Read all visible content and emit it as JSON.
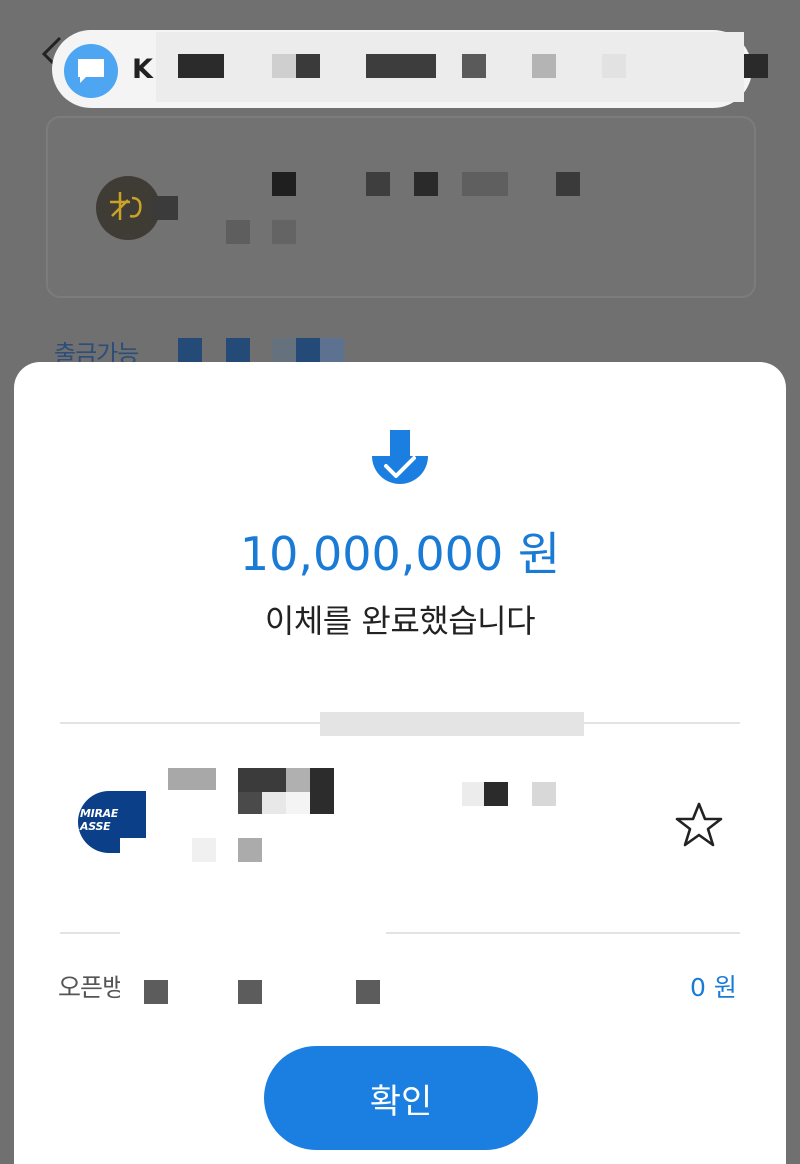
{
  "background": {
    "withdraw_label": "출금가능"
  },
  "notification": {
    "sender_initial": "K",
    "icon": "chat-bubble-icon"
  },
  "transfer": {
    "status_icon": "download-check-icon",
    "amount": "10,000,000 원",
    "message": "이체를 완료했습니다"
  },
  "recipient": {
    "bank_logo_line1": "MIRAE",
    "bank_logo_line2": "ASSE",
    "favorite_icon": "star-outline-icon"
  },
  "open_banking": {
    "label": "오픈뱅",
    "value": "0 원"
  },
  "confirm_button": {
    "label": "확인"
  },
  "colors": {
    "accent": "#1a7fe0",
    "amount_text": "#1a7bd6",
    "bank_brand": "#0b3f87",
    "notification_icon": "#4ea6f3"
  }
}
